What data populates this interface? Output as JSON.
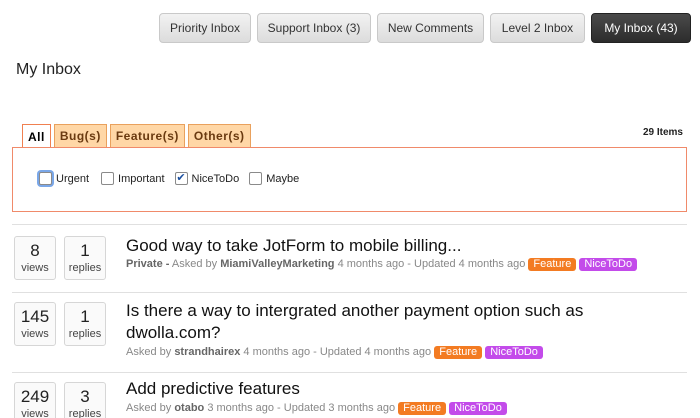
{
  "inbox_tabs": [
    {
      "label": "Priority Inbox",
      "active": false
    },
    {
      "label": "Support Inbox (3)",
      "active": false
    },
    {
      "label": "New Comments",
      "active": false
    },
    {
      "label": "Level 2 Inbox",
      "active": false
    },
    {
      "label": "My Inbox (43)",
      "active": true
    }
  ],
  "page_title": "My Inbox",
  "filter_tabs": [
    {
      "label": "All",
      "active": true
    },
    {
      "label": "Bug(s)",
      "active": false
    },
    {
      "label": "Feature(s)",
      "active": false
    },
    {
      "label": "Other(s)",
      "active": false
    }
  ],
  "item_count": "29 Items",
  "priority_filters": [
    {
      "label": "Urgent",
      "checked": false
    },
    {
      "label": "Important",
      "checked": false
    },
    {
      "label": "NiceToDo",
      "checked": true
    },
    {
      "label": "Maybe",
      "checked": false
    }
  ],
  "questions": [
    {
      "views": "8",
      "views_label": "views",
      "replies": "1",
      "replies_label": "replies",
      "title": "Good way to take JotForm to mobile billing...",
      "private": "Private -",
      "asked_prefix": "Asked by",
      "author": "MiamiValleyMarketing",
      "asked_time": "4 months ago",
      "sep": "-",
      "updated": "Updated 4 months ago",
      "tags": [
        {
          "label": "Feature",
          "kind": "feature"
        },
        {
          "label": "NiceToDo",
          "kind": "nice"
        }
      ]
    },
    {
      "views": "145",
      "views_label": "views",
      "replies": "1",
      "replies_label": "replies",
      "title": "Is there a way to intergrated another payment option such as dwolla.com?",
      "private": "",
      "asked_prefix": "Asked by",
      "author": "strandhairex",
      "asked_time": "4 months ago",
      "sep": "-",
      "updated": "Updated 4 months ago",
      "tags": [
        {
          "label": "Feature",
          "kind": "feature"
        },
        {
          "label": "NiceToDo",
          "kind": "nice"
        }
      ]
    },
    {
      "views": "249",
      "views_label": "views",
      "replies": "3",
      "replies_label": "replies",
      "title": "Add predictive features",
      "private": "",
      "asked_prefix": "Asked by",
      "author": "otabo",
      "asked_time": "3 months ago",
      "sep": "-",
      "updated": "Updated 3 months ago",
      "tags": [
        {
          "label": "Feature",
          "kind": "feature"
        },
        {
          "label": "NiceToDo",
          "kind": "nice"
        }
      ]
    }
  ]
}
